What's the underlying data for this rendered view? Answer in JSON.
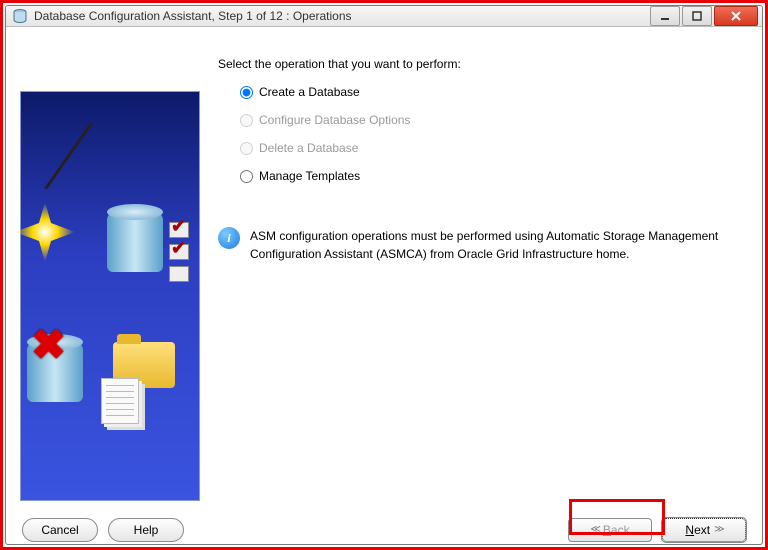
{
  "window": {
    "title": "Database Configuration Assistant, Step 1 of 12 : Operations"
  },
  "prompt": "Select the operation that you want to perform:",
  "options": {
    "create": "Create a Database",
    "configure": "Configure Database Options",
    "delete": "Delete a Database",
    "templates": "Manage Templates"
  },
  "info": "ASM configuration operations must be performed using Automatic Storage Management Configuration Assistant (ASMCA) from Oracle Grid Infrastructure home.",
  "buttons": {
    "cancel": "Cancel",
    "help": "Help",
    "back_u": "B",
    "back_rest": "ack",
    "next_u": "N",
    "next_rest": "ext"
  }
}
